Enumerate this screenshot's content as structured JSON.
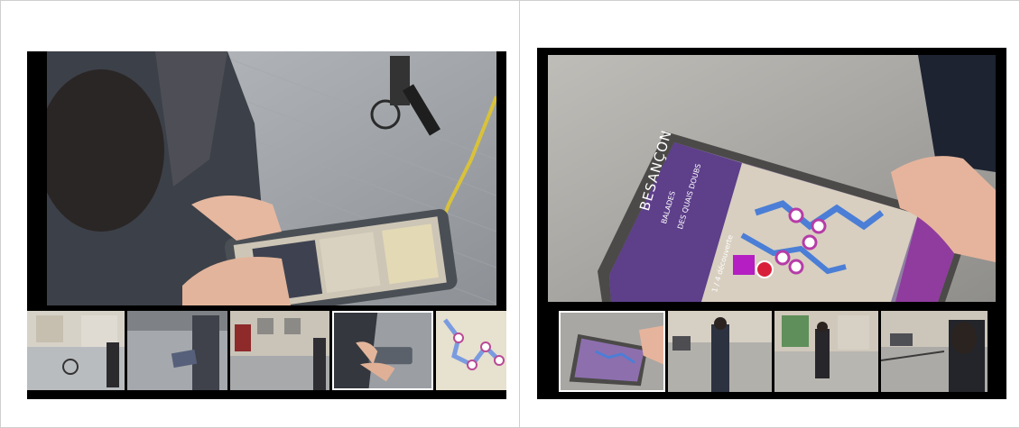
{
  "colors": {
    "page_bg": "#ffffff",
    "panel_bg": "#000000",
    "frame_border": "#cfcfcf",
    "pavement": "#9a9ea3",
    "map_purple": "#6a3bb0",
    "pin": "#d02b8c"
  },
  "left_viewer": {
    "photo_subject": "person-using-smartphone-on-street",
    "thumbnails": [
      {
        "subject": "street-with-cyclist"
      },
      {
        "subject": "person-with-phone-crossing-street"
      },
      {
        "subject": "building-facade-street"
      },
      {
        "subject": "hands-holding-phone",
        "selected": true
      },
      {
        "subject": "route-map"
      }
    ]
  },
  "right_viewer": {
    "photo_subject": "hand-holding-phone-with-map-app",
    "phone_screen_text": {
      "city": "BESANÇON",
      "subtitle_1": "BALADES",
      "subtitle_2": "DES QUAIS DOUBS",
      "status": "1 / 4 découverte"
    },
    "thumbnails": [
      {
        "subject": "phone-with-map-app",
        "selected": true
      },
      {
        "subject": "woman-in-street"
      },
      {
        "subject": "woman-at-storefront"
      },
      {
        "subject": "woman-by-street-railing"
      }
    ]
  }
}
